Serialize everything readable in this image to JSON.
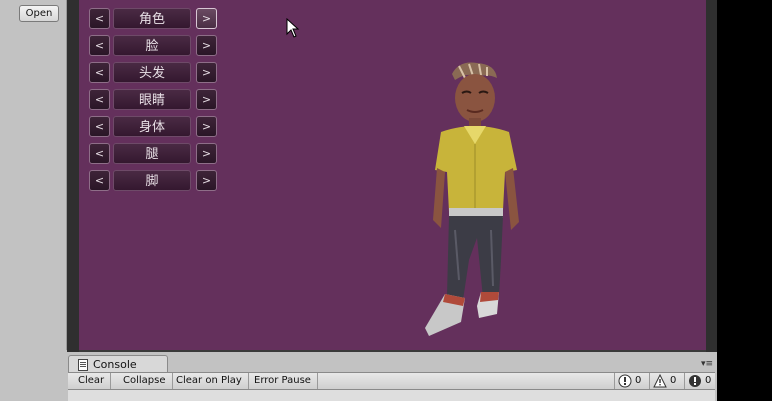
{
  "toolbar_left": {
    "open_label": "Open"
  },
  "customizer": {
    "rows": [
      {
        "prev": "<",
        "label": "角色",
        "next": ">"
      },
      {
        "prev": "<",
        "label": "脸",
        "next": ">"
      },
      {
        "prev": "<",
        "label": "头发",
        "next": ">"
      },
      {
        "prev": "<",
        "label": "眼睛",
        "next": ">"
      },
      {
        "prev": "<",
        "label": "身体",
        "next": ">"
      },
      {
        "prev": "<",
        "label": "腿",
        "next": ">"
      },
      {
        "prev": "<",
        "label": "脚",
        "next": ">"
      }
    ]
  },
  "console": {
    "tab_label": "Console",
    "buttons": {
      "clear": "Clear",
      "collapse": "Collapse",
      "clear_on_play": "Clear on Play",
      "error_pause": "Error Pause"
    },
    "counts": {
      "info": "0",
      "warning": "0",
      "error": "0"
    }
  },
  "colors": {
    "viewport_bg": "#64305c",
    "button_bg": "#3e2438"
  }
}
